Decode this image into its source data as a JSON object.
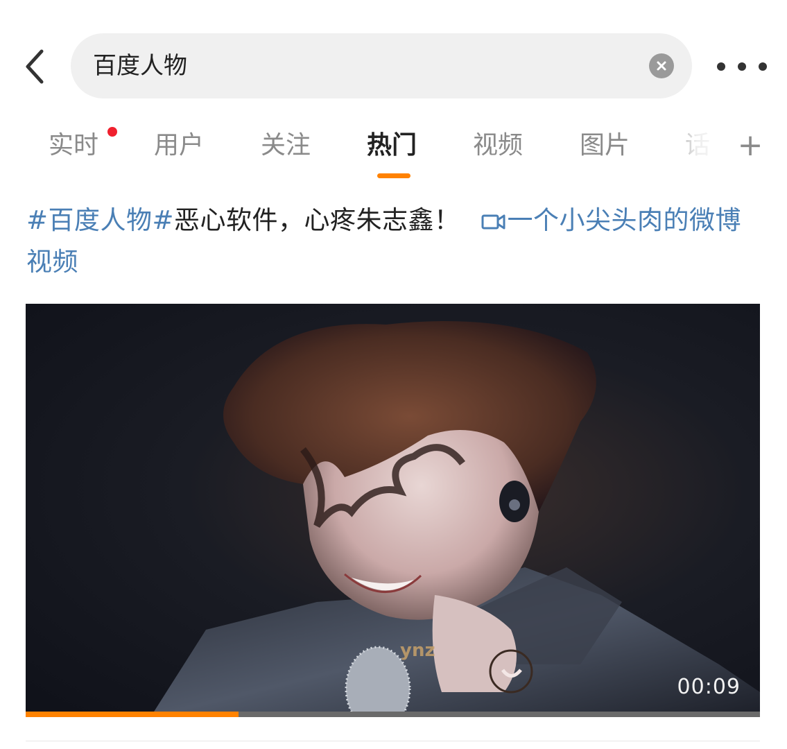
{
  "header": {
    "search_query": "百度人物",
    "back_icon": "chevron-left-icon",
    "clear_icon": "close-icon",
    "more_icon": "more-horizontal-icon"
  },
  "tabs": [
    {
      "label": "实时",
      "has_dot": true
    },
    {
      "label": "用户"
    },
    {
      "label": "关注"
    },
    {
      "label": "热门",
      "active": true
    },
    {
      "label": "视频"
    },
    {
      "label": "图片"
    },
    {
      "label": "话"
    }
  ],
  "tabs_add_label": "+",
  "colors": {
    "accent": "#ff8200",
    "link": "#4a7fb5",
    "dot": "#f0202e"
  },
  "post": {
    "hashtag": "#百度人物#",
    "body": "恶心软件，心疼朱志鑫！",
    "video_link": "一个小尖头肉的微博视频"
  },
  "video": {
    "watermark": "ynz",
    "time": "00:09",
    "progress": 0.29
  }
}
